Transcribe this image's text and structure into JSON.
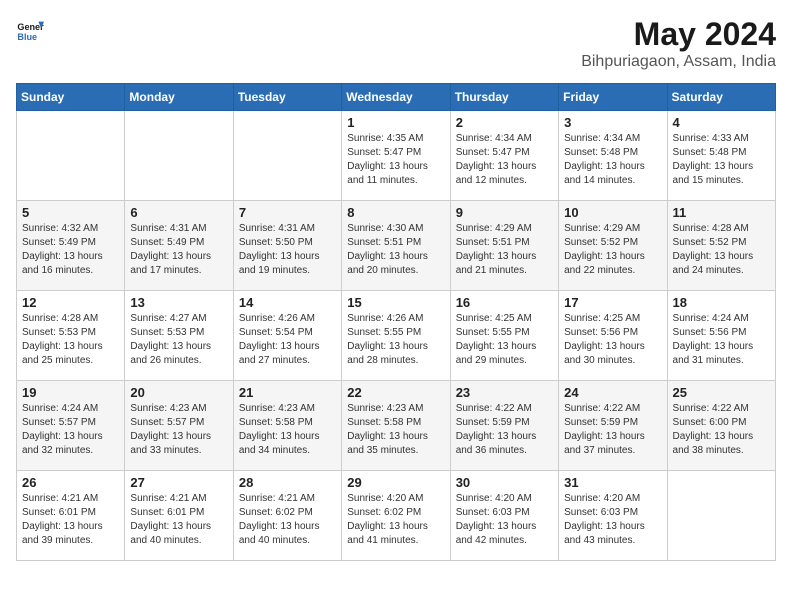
{
  "header": {
    "logo_line1": "General",
    "logo_line2": "Blue",
    "month_year": "May 2024",
    "location": "Bihpuriagaon, Assam, India"
  },
  "weekdays": [
    "Sunday",
    "Monday",
    "Tuesday",
    "Wednesday",
    "Thursday",
    "Friday",
    "Saturday"
  ],
  "weeks": [
    [
      {
        "day": "",
        "info": ""
      },
      {
        "day": "",
        "info": ""
      },
      {
        "day": "",
        "info": ""
      },
      {
        "day": "1",
        "info": "Sunrise: 4:35 AM\nSunset: 5:47 PM\nDaylight: 13 hours\nand 11 minutes."
      },
      {
        "day": "2",
        "info": "Sunrise: 4:34 AM\nSunset: 5:47 PM\nDaylight: 13 hours\nand 12 minutes."
      },
      {
        "day": "3",
        "info": "Sunrise: 4:34 AM\nSunset: 5:48 PM\nDaylight: 13 hours\nand 14 minutes."
      },
      {
        "day": "4",
        "info": "Sunrise: 4:33 AM\nSunset: 5:48 PM\nDaylight: 13 hours\nand 15 minutes."
      }
    ],
    [
      {
        "day": "5",
        "info": "Sunrise: 4:32 AM\nSunset: 5:49 PM\nDaylight: 13 hours\nand 16 minutes."
      },
      {
        "day": "6",
        "info": "Sunrise: 4:31 AM\nSunset: 5:49 PM\nDaylight: 13 hours\nand 17 minutes."
      },
      {
        "day": "7",
        "info": "Sunrise: 4:31 AM\nSunset: 5:50 PM\nDaylight: 13 hours\nand 19 minutes."
      },
      {
        "day": "8",
        "info": "Sunrise: 4:30 AM\nSunset: 5:51 PM\nDaylight: 13 hours\nand 20 minutes."
      },
      {
        "day": "9",
        "info": "Sunrise: 4:29 AM\nSunset: 5:51 PM\nDaylight: 13 hours\nand 21 minutes."
      },
      {
        "day": "10",
        "info": "Sunrise: 4:29 AM\nSunset: 5:52 PM\nDaylight: 13 hours\nand 22 minutes."
      },
      {
        "day": "11",
        "info": "Sunrise: 4:28 AM\nSunset: 5:52 PM\nDaylight: 13 hours\nand 24 minutes."
      }
    ],
    [
      {
        "day": "12",
        "info": "Sunrise: 4:28 AM\nSunset: 5:53 PM\nDaylight: 13 hours\nand 25 minutes."
      },
      {
        "day": "13",
        "info": "Sunrise: 4:27 AM\nSunset: 5:53 PM\nDaylight: 13 hours\nand 26 minutes."
      },
      {
        "day": "14",
        "info": "Sunrise: 4:26 AM\nSunset: 5:54 PM\nDaylight: 13 hours\nand 27 minutes."
      },
      {
        "day": "15",
        "info": "Sunrise: 4:26 AM\nSunset: 5:55 PM\nDaylight: 13 hours\nand 28 minutes."
      },
      {
        "day": "16",
        "info": "Sunrise: 4:25 AM\nSunset: 5:55 PM\nDaylight: 13 hours\nand 29 minutes."
      },
      {
        "day": "17",
        "info": "Sunrise: 4:25 AM\nSunset: 5:56 PM\nDaylight: 13 hours\nand 30 minutes."
      },
      {
        "day": "18",
        "info": "Sunrise: 4:24 AM\nSunset: 5:56 PM\nDaylight: 13 hours\nand 31 minutes."
      }
    ],
    [
      {
        "day": "19",
        "info": "Sunrise: 4:24 AM\nSunset: 5:57 PM\nDaylight: 13 hours\nand 32 minutes."
      },
      {
        "day": "20",
        "info": "Sunrise: 4:23 AM\nSunset: 5:57 PM\nDaylight: 13 hours\nand 33 minutes."
      },
      {
        "day": "21",
        "info": "Sunrise: 4:23 AM\nSunset: 5:58 PM\nDaylight: 13 hours\nand 34 minutes."
      },
      {
        "day": "22",
        "info": "Sunrise: 4:23 AM\nSunset: 5:58 PM\nDaylight: 13 hours\nand 35 minutes."
      },
      {
        "day": "23",
        "info": "Sunrise: 4:22 AM\nSunset: 5:59 PM\nDaylight: 13 hours\nand 36 minutes."
      },
      {
        "day": "24",
        "info": "Sunrise: 4:22 AM\nSunset: 5:59 PM\nDaylight: 13 hours\nand 37 minutes."
      },
      {
        "day": "25",
        "info": "Sunrise: 4:22 AM\nSunset: 6:00 PM\nDaylight: 13 hours\nand 38 minutes."
      }
    ],
    [
      {
        "day": "26",
        "info": "Sunrise: 4:21 AM\nSunset: 6:01 PM\nDaylight: 13 hours\nand 39 minutes."
      },
      {
        "day": "27",
        "info": "Sunrise: 4:21 AM\nSunset: 6:01 PM\nDaylight: 13 hours\nand 40 minutes."
      },
      {
        "day": "28",
        "info": "Sunrise: 4:21 AM\nSunset: 6:02 PM\nDaylight: 13 hours\nand 40 minutes."
      },
      {
        "day": "29",
        "info": "Sunrise: 4:20 AM\nSunset: 6:02 PM\nDaylight: 13 hours\nand 41 minutes."
      },
      {
        "day": "30",
        "info": "Sunrise: 4:20 AM\nSunset: 6:03 PM\nDaylight: 13 hours\nand 42 minutes."
      },
      {
        "day": "31",
        "info": "Sunrise: 4:20 AM\nSunset: 6:03 PM\nDaylight: 13 hours\nand 43 minutes."
      },
      {
        "day": "",
        "info": ""
      }
    ]
  ]
}
